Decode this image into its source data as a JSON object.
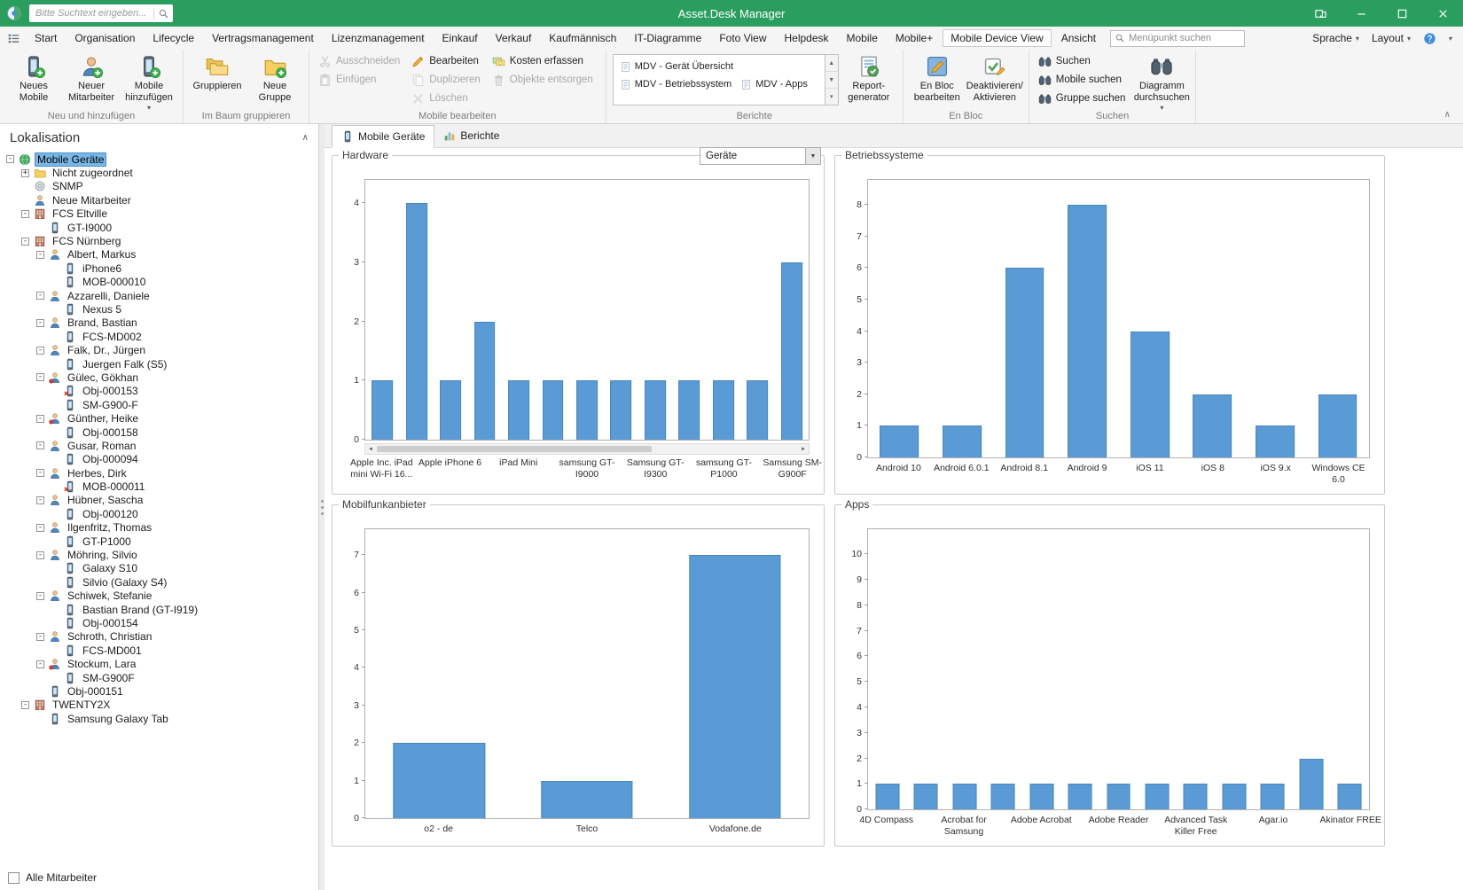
{
  "titlebar": {
    "search_placeholder": "Bitte Suchtext eingeben...",
    "title": "Asset.Desk Manager"
  },
  "menubar": {
    "tabs": [
      "Start",
      "Organisation",
      "Lifecycle",
      "Vertragsmanagement",
      "Lizenzmanagement",
      "Einkauf",
      "Verkauf",
      "Kaufmännisch",
      "IT-Diagramme",
      "Foto View",
      "Helpdesk",
      "Mobile",
      "Mobile+",
      "Mobile Device View",
      "Ansicht"
    ],
    "active_tab": "Mobile Device View",
    "search_placeholder": "Menüpunkt suchen",
    "right_items": [
      "Sprache",
      "Layout"
    ]
  },
  "ribbon": {
    "groups": [
      {
        "label": "Neu und hinzufügen",
        "columns": [
          [
            {
              "label": "Neues\nMobile",
              "icon": "mobile-add",
              "size": "lg"
            }
          ],
          [
            {
              "label": "Neuer\nMitarbeiter",
              "icon": "person-add",
              "size": "lg"
            }
          ],
          [
            {
              "label": "Mobile\nhinzufügen",
              "icon": "mobile-add",
              "size": "lg",
              "dropdown": true
            }
          ]
        ]
      },
      {
        "label": "Im Baum gruppieren",
        "columns": [
          [
            {
              "label": "Gruppieren",
              "icon": "folders",
              "size": "lg"
            }
          ],
          [
            {
              "label": "Neue Gruppe",
              "icon": "folder-add",
              "size": "lg"
            }
          ]
        ]
      },
      {
        "label": "Mobile bearbeiten",
        "columns": [
          [
            {
              "label": "Ausschneiden",
              "icon": "cut",
              "size": "sm",
              "disabled": true
            },
            {
              "label": "Einfügen",
              "icon": "paste",
              "size": "sm",
              "disabled": true
            }
          ],
          [
            {
              "label": "Bear­beiten",
              "icon": "edit",
              "size": "sm"
            },
            {
              "label": "Duplizieren",
              "icon": "duplicate",
              "size": "sm",
              "disabled": true
            },
            {
              "label": "Löschen",
              "icon": "delete",
              "size": "sm",
              "disabled": true
            }
          ],
          [
            {
              "label": "Kosten erfassen",
              "icon": "costs",
              "size": "sm"
            },
            {
              "label": "Objekte entsorgen",
              "icon": "dispose",
              "size": "sm",
              "disabled": true
            }
          ]
        ]
      },
      {
        "label": "Berichte",
        "gallery": [
          "MDV - Gerät Übersicht",
          "MDV - Betriebssystem",
          "MDV - Apps"
        ],
        "columns": [
          [
            {
              "label": "Report-\ngenerator",
              "icon": "report-gen",
              "size": "lg"
            }
          ]
        ]
      },
      {
        "label": "En Bloc",
        "columns": [
          [
            {
              "label": "En Bloc\nbearbeiten",
              "icon": "enbloc",
              "size": "lg"
            }
          ],
          [
            {
              "label": "Deaktivieren/\nAktivieren",
              "icon": "activate",
              "size": "lg"
            }
          ]
        ]
      },
      {
        "label": "Suchen",
        "columns": [
          [
            {
              "label": "Suchen",
              "icon": "binoculars",
              "size": "sm"
            },
            {
              "label": "Mobile suchen",
              "icon": "binoculars",
              "size": "sm"
            },
            {
              "label": "Gruppe suchen",
              "icon": "binoculars",
              "size": "sm"
            }
          ],
          [
            {
              "label": "Diagramm\ndurchsuchen",
              "icon": "binoculars",
              "size": "lg",
              "dropdown": true
            }
          ]
        ]
      }
    ]
  },
  "sidebar": {
    "title": "Lokalisation",
    "footer_checkbox": "Alle Mitarbeiter",
    "tree": [
      {
        "label": "Mobile Geräte",
        "level": 0,
        "icon": "globe",
        "expander": "minus",
        "selected": true
      },
      {
        "label": "Nicht zugeordnet",
        "level": 1,
        "icon": "folder",
        "expander": "plus"
      },
      {
        "label": "SNMP",
        "level": 1,
        "icon": "disc",
        "expander": "none"
      },
      {
        "label": "Neue Mitarbeiter",
        "level": 1,
        "icon": "person",
        "expander": "none"
      },
      {
        "label": "FCS Eltville",
        "level": 1,
        "icon": "building",
        "expander": "minus"
      },
      {
        "label": "GT-I9000",
        "level": 2,
        "icon": "phone",
        "expander": "none"
      },
      {
        "label": "FCS Nürnberg",
        "level": 1,
        "icon": "building",
        "expander": "minus"
      },
      {
        "label": "Albert, Markus",
        "level": 2,
        "icon": "person",
        "expander": "minus"
      },
      {
        "label": "iPhone6",
        "level": 3,
        "icon": "phone",
        "expander": "none"
      },
      {
        "label": "MOB-000010",
        "level": 3,
        "icon": "phone",
        "expander": "none"
      },
      {
        "label": "Azzarelli, Daniele",
        "level": 2,
        "icon": "person",
        "expander": "minus"
      },
      {
        "label": "Nexus 5",
        "level": 3,
        "icon": "phone",
        "expander": "none"
      },
      {
        "label": "Brand, Bastian",
        "level": 2,
        "icon": "person",
        "expander": "minus"
      },
      {
        "label": "FCS-MD002",
        "level": 3,
        "icon": "phone",
        "expander": "none"
      },
      {
        "label": "Falk, Dr., Jürgen",
        "level": 2,
        "icon": "person",
        "expander": "minus"
      },
      {
        "label": "Juergen Falk (S5)",
        "level": 3,
        "icon": "phone",
        "expander": "none"
      },
      {
        "label": "Gülec, Gökhan",
        "level": 2,
        "icon": "person-red",
        "expander": "minus"
      },
      {
        "label": "Obj-000153",
        "level": 3,
        "icon": "phone-red",
        "expander": "none"
      },
      {
        "label": "SM-G900-F",
        "level": 3,
        "icon": "phone",
        "expander": "none"
      },
      {
        "label": "Günther, Heike",
        "level": 2,
        "icon": "person-red",
        "expander": "minus"
      },
      {
        "label": "Obj-000158",
        "level": 3,
        "icon": "phone",
        "expander": "none"
      },
      {
        "label": "Gusar, Roman",
        "level": 2,
        "icon": "person",
        "expander": "minus"
      },
      {
        "label": "Obj-000094",
        "level": 3,
        "icon": "phone",
        "expander": "none"
      },
      {
        "label": "Herbes, Dirk",
        "level": 2,
        "icon": "person",
        "expander": "minus"
      },
      {
        "label": "MOB-000011",
        "level": 3,
        "icon": "phone-red",
        "expander": "none"
      },
      {
        "label": "Hübner, Sascha",
        "level": 2,
        "icon": "person",
        "expander": "minus"
      },
      {
        "label": "Obj-000120",
        "level": 3,
        "icon": "phone",
        "expander": "none"
      },
      {
        "label": "Ilgenfritz, Thomas",
        "level": 2,
        "icon": "person",
        "expander": "minus"
      },
      {
        "label": "GT-P1000",
        "level": 3,
        "icon": "phone",
        "expander": "none"
      },
      {
        "label": "Möhring, Silvio",
        "level": 2,
        "icon": "person",
        "expander": "minus"
      },
      {
        "label": "Galaxy S10",
        "level": 3,
        "icon": "phone",
        "expander": "none"
      },
      {
        "label": "Silvio (Galaxy S4)",
        "level": 3,
        "icon": "phone",
        "expander": "none"
      },
      {
        "label": "Schiwek, Stefanie",
        "level": 2,
        "icon": "person",
        "expander": "minus"
      },
      {
        "label": "Bastian Brand (GT-I919)",
        "level": 3,
        "icon": "phone",
        "expander": "none"
      },
      {
        "label": "Obj-000154",
        "level": 3,
        "icon": "phone",
        "expander": "none"
      },
      {
        "label": "Schroth, Christian",
        "level": 2,
        "icon": "person",
        "expander": "minus"
      },
      {
        "label": "FCS-MD001",
        "level": 3,
        "icon": "phone",
        "expander": "none"
      },
      {
        "label": "Stockum, Lara",
        "level": 2,
        "icon": "person-red",
        "expander": "minus"
      },
      {
        "label": "SM-G900F",
        "level": 3,
        "icon": "phone",
        "expander": "none"
      },
      {
        "label": "Obj-000151",
        "level": 2,
        "icon": "phone",
        "expander": "none"
      },
      {
        "label": "TWENTY2X",
        "level": 1,
        "icon": "building",
        "expander": "minus"
      },
      {
        "label": "Samsung Galaxy Tab",
        "level": 2,
        "icon": "phone",
        "expander": "none"
      }
    ]
  },
  "main": {
    "tabs": [
      {
        "label": "Mobile Geräte",
        "icon": "phone",
        "active": true
      },
      {
        "label": "Berichte",
        "icon": "chart-bars",
        "active": false
      }
    ]
  },
  "chart_data": [
    {
      "type": "bar",
      "title": "Hardware",
      "dropdown_value": "Geräte",
      "scrollbar": true,
      "ylim": [
        0,
        4
      ],
      "ymax": 4,
      "bar_color": "#5b9bd5",
      "values": [
        1,
        4,
        1,
        2,
        1,
        1,
        1,
        1,
        1,
        1,
        1,
        1,
        3
      ],
      "labels": [
        {
          "bar": 0,
          "text": "Apple Inc. iPad\nmini Wi-Fi 16..."
        },
        {
          "bar": 2,
          "text": "Apple iPhone 6"
        },
        {
          "bar": 4,
          "text": "iPad Mini"
        },
        {
          "bar": 6,
          "text": "samsung GT-\nI9000"
        },
        {
          "bar": 8,
          "text": "Samsung GT-\nI9300"
        },
        {
          "bar": 10,
          "text": "samsung GT-\nP1000"
        },
        {
          "bar": 12,
          "text": "Samsung SM-\nG900F"
        }
      ]
    },
    {
      "type": "bar",
      "title": "Betriebssysteme",
      "scrollbar": false,
      "ylim": [
        0,
        8
      ],
      "ymax": 8,
      "bar_color": "#5b9bd5",
      "values": [
        1,
        1,
        6,
        8,
        4,
        2,
        1,
        2
      ],
      "labels": [
        {
          "bar": 0,
          "text": "Android 10"
        },
        {
          "bar": 1,
          "text": "Android 6.0.1"
        },
        {
          "bar": 2,
          "text": "Android 8.1"
        },
        {
          "bar": 3,
          "text": "Android 9"
        },
        {
          "bar": 4,
          "text": "iOS 11"
        },
        {
          "bar": 5,
          "text": "iOS 8"
        },
        {
          "bar": 6,
          "text": "iOS 9.x"
        },
        {
          "bar": 7,
          "text": "Windows CE\n6.0"
        }
      ]
    },
    {
      "type": "bar",
      "title": "Mobilfunkanbieter",
      "scrollbar": false,
      "ylim": [
        0,
        7
      ],
      "ymax": 7,
      "bar_color": "#5b9bd5",
      "values": [
        2,
        1,
        7
      ],
      "labels": [
        {
          "bar": 0,
          "text": "o2 - de"
        },
        {
          "bar": 1,
          "text": "Telco"
        },
        {
          "bar": 2,
          "text": "Vodafone.de"
        }
      ]
    },
    {
      "type": "bar",
      "title": "Apps",
      "scrollbar": false,
      "ylim": [
        0,
        10
      ],
      "ymax": 10,
      "bar_color": "#5b9bd5",
      "values": [
        1,
        1,
        1,
        1,
        1,
        1,
        1,
        1,
        1,
        1,
        1,
        2,
        1
      ],
      "labels": [
        {
          "bar": 0,
          "text": "4D Compass"
        },
        {
          "bar": 2,
          "text": "Acrobat for\nSamsung"
        },
        {
          "bar": 4,
          "text": "Adobe Acrobat"
        },
        {
          "bar": 6,
          "text": "Adobe Reader"
        },
        {
          "bar": 8,
          "text": "Advanced Task\nKiller Free"
        },
        {
          "bar": 10,
          "text": "Agar.io"
        },
        {
          "bar": 12,
          "text": "Akinator FREE"
        }
      ]
    }
  ],
  "colors": {
    "titlebar": "#2a9e5f",
    "bar": "#5b9bd5",
    "selection": "#79b7e6"
  }
}
